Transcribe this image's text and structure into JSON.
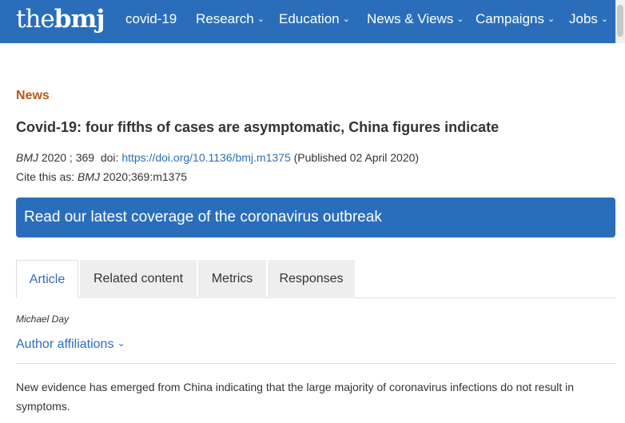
{
  "nav": {
    "logo_thin": "the",
    "logo_bold": "bmj",
    "items": [
      {
        "label": "covid-19",
        "chevron": false
      },
      {
        "label": "Research",
        "chevron": true
      },
      {
        "label": "Education",
        "chevron": true
      },
      {
        "label": "News & Views",
        "chevron": true
      },
      {
        "label": "Campaigns",
        "chevron": true
      },
      {
        "label": "Jobs",
        "chevron": true
      }
    ],
    "chevron_glyph": "⌄",
    "color": "#2a6ebb"
  },
  "article": {
    "section": "News",
    "title": "Covid-19: four fifths of cases are asymptomatic, China figures indicate",
    "journal": "BMJ",
    "year_volume": " 2020 ; 369  doi: ",
    "doi_url": "https://doi.org/10.1136/bmj.m1375",
    "published": " (Published 02 April 2020)",
    "cite_prefix": "Cite this as: ",
    "cite_journal": "BMJ",
    "cite_ref": " 2020;369:m1375",
    "section_color": "#bd5612"
  },
  "banner": {
    "text": "Read our latest coverage of the coronavirus outbreak"
  },
  "tabs": [
    {
      "label": "Article",
      "active": true
    },
    {
      "label": "Related content",
      "active": false
    },
    {
      "label": "Metrics",
      "active": false
    },
    {
      "label": "Responses",
      "active": false
    }
  ],
  "author": {
    "name": "Michael Day",
    "affiliations_label": "Author affiliations",
    "chevron": "⌄"
  },
  "body": {
    "paragraph": "New evidence has emerged from China indicating that the large majority of coronavirus infections do not result in symptoms."
  }
}
